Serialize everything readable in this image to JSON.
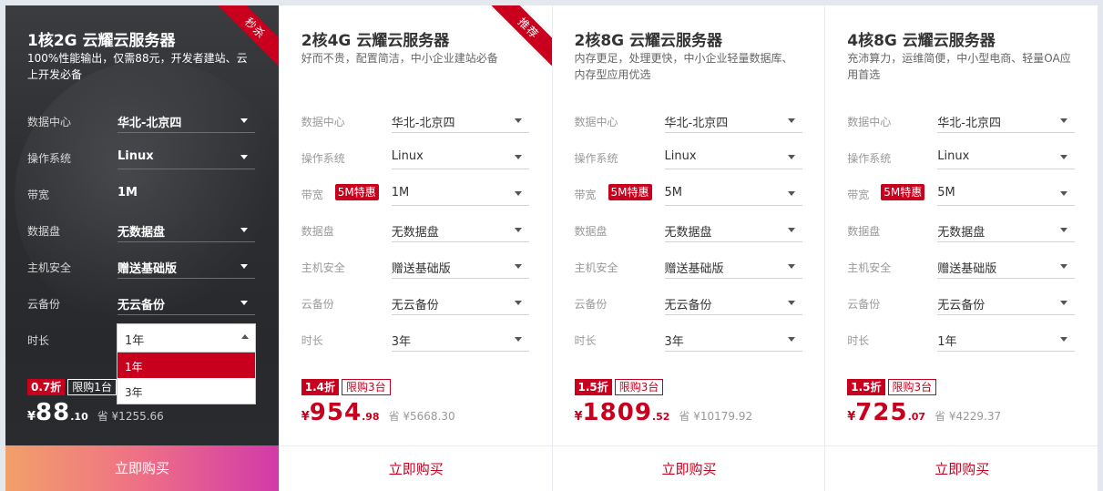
{
  "labels": {
    "datacenter": "数据中心",
    "os": "操作系统",
    "bandwidth": "带宽",
    "disk": "数据盘",
    "security": "主机安全",
    "backup": "云备份",
    "duration": "时长"
  },
  "cards": [
    {
      "ribbon": "秒杀",
      "title": "1核2G 云耀云服务器",
      "desc": "100%性能输出，仅需88元，开发者建站、云上开发必备",
      "datacenter": "华北-北京四",
      "os": "Linux",
      "bandwidth_tag": "",
      "bandwidth": "1M",
      "disk": "无数据盘",
      "security": "赠送基础版",
      "backup": "无云备份",
      "duration": "1年",
      "duration_options": [
        "1年",
        "3年"
      ],
      "discount": "0.7折",
      "limit": "限购1台",
      "currency": "¥",
      "price_int": "88",
      "price_dec": ".10",
      "orig": "省 ¥1255.66",
      "buy": "立即购买"
    },
    {
      "ribbon": "推荐",
      "title": "2核4G 云耀云服务器",
      "desc": "好而不贵，配置简洁，中小企业建站必备",
      "datacenter": "华北-北京四",
      "os": "Linux",
      "bandwidth_tag": "5M特惠",
      "bandwidth": "1M",
      "disk": "无数据盘",
      "security": "赠送基础版",
      "backup": "无云备份",
      "duration": "3年",
      "discount": "1.4折",
      "limit": "限购3台",
      "currency": "¥",
      "price_int": "954",
      "price_dec": ".98",
      "orig": "省 ¥5668.30",
      "buy": "立即购买"
    },
    {
      "title": "2核8G 云耀云服务器",
      "desc": "内存更足，处理更快，中小企业轻量数据库、内存型应用优选",
      "datacenter": "华北-北京四",
      "os": "Linux",
      "bandwidth_tag": "5M特惠",
      "bandwidth": "5M",
      "disk": "无数据盘",
      "security": "赠送基础版",
      "backup": "无云备份",
      "duration": "3年",
      "discount": "1.5折",
      "limit": "限购3台",
      "currency": "¥",
      "price_int": "1809",
      "price_dec": ".52",
      "orig": "省 ¥10179.92",
      "buy": "立即购买"
    },
    {
      "title": "4核8G 云耀云服务器",
      "desc": "充沛算力，运维简便，中小型电商、轻量OA应用首选",
      "datacenter": "华北-北京四",
      "os": "Linux",
      "bandwidth_tag": "5M特惠",
      "bandwidth": "5M",
      "disk": "无数据盘",
      "security": "赠送基础版",
      "backup": "无云备份",
      "duration": "1年",
      "discount": "1.5折",
      "limit": "限购3台",
      "currency": "¥",
      "price_int": "725",
      "price_dec": ".07",
      "orig": "省 ¥4229.37",
      "buy": "立即购买"
    }
  ]
}
